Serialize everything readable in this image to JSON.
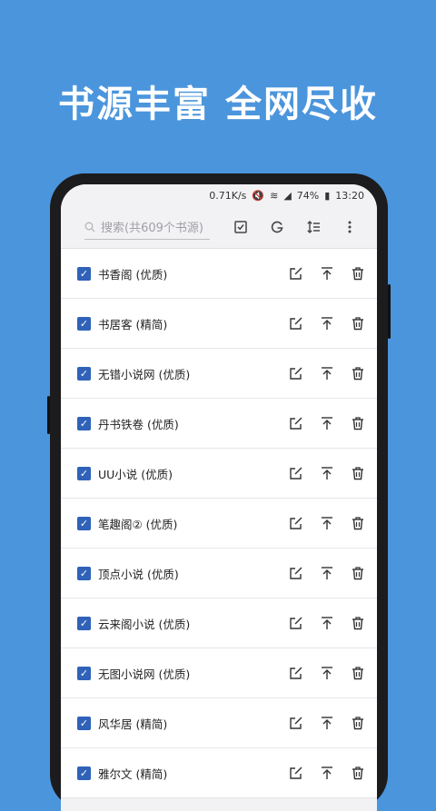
{
  "headline": "书源丰富  全网尽收",
  "status": {
    "speed": "0.71K/s",
    "battery": "74%",
    "time": "13:20"
  },
  "toolbar": {
    "search_placeholder": "搜索(共609个书源)"
  },
  "sources": [
    {
      "label": "书香阁 (优质)"
    },
    {
      "label": "书居客 (精简)"
    },
    {
      "label": "无错小说网 (优质)"
    },
    {
      "label": "丹书铁卷 (优质)"
    },
    {
      "label": "UU小说 (优质)"
    },
    {
      "label": "笔趣阁② (优质)"
    },
    {
      "label": "顶点小说 (优质)"
    },
    {
      "label": "云来阁小说 (优质)"
    },
    {
      "label": "无图小说网 (优质)"
    },
    {
      "label": "风华居 (精简)"
    },
    {
      "label": "雅尔文 (精简)"
    }
  ],
  "colors": {
    "background": "#4b95dd",
    "checkbox": "#2f62b8"
  }
}
